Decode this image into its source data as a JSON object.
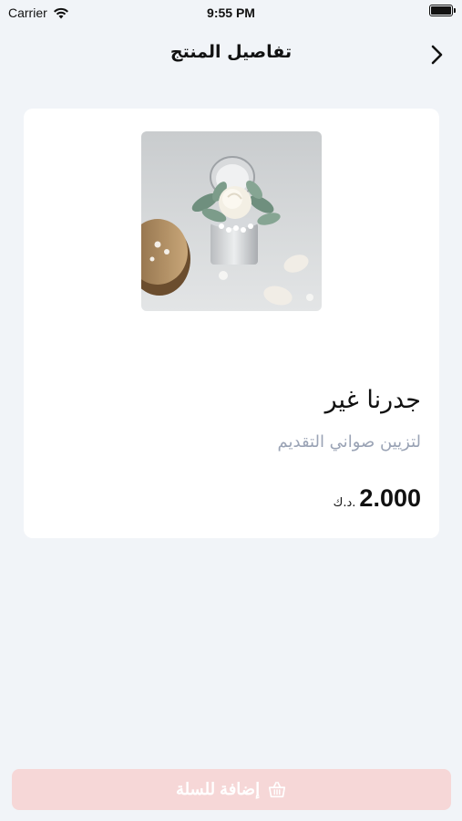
{
  "status_bar": {
    "carrier": "Carrier",
    "time": "9:55 PM",
    "icons": [
      "wifi-icon",
      "battery-icon"
    ]
  },
  "nav": {
    "title": "تفاصيل المنتج",
    "back_icon": "chevron-right-icon"
  },
  "product": {
    "name": "جدرنا غير",
    "description": "لتزيين صواني التقديم",
    "price": "2.000",
    "currency": "د.ك."
  },
  "cart_button": {
    "label": "إضافة للسلة",
    "icon": "basket-icon",
    "color": "#f6d7d7"
  },
  "colors": {
    "background": "#f1f4f8",
    "card": "#ffffff",
    "description_text": "#9aa3b5"
  }
}
